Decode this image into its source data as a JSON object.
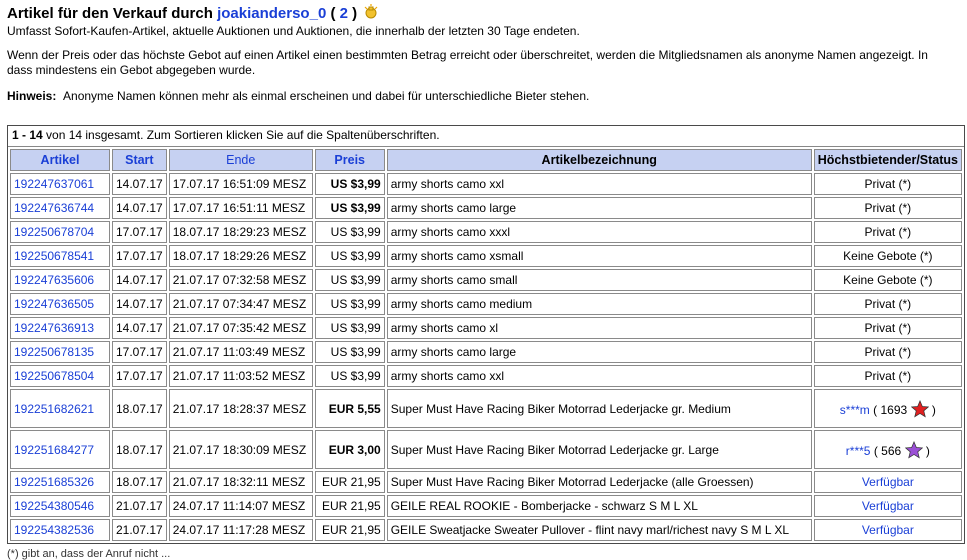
{
  "header": {
    "title_prefix": "Artikel für den Verkauf durch",
    "username": "joakianderso_0",
    "paren_open": "(",
    "feedback_count": "2",
    "paren_close": ")",
    "subtitle": "Umfasst Sofort-Kaufen-Artikel, aktuelle Auktionen und Auktionen, die innerhalb der letzten 30 Tage endeten."
  },
  "notice": {
    "line1": "Wenn der Preis oder das höchste Gebot auf einen Artikel einen bestimmten Betrag erreicht oder überschreitet, werden die Mitgliedsnamen als anonyme Namen angezeigt. In",
    "line2": "dass mindestens ein Gebot abgegeben wurde.",
    "hint_label": "Hinweis:",
    "hint_text": "Anonyme Namen können mehr als einmal erscheinen und dabei für unterschiedliche Bieter stehen."
  },
  "table": {
    "range": "1 - 14",
    "count_text": "von 14 insgesamt. Zum Sortieren klicken Sie auf die Spaltenüberschriften.",
    "columns": {
      "artikel": "Artikel",
      "start": "Start",
      "ende": "Ende",
      "preis": "Preis",
      "bezeichnung": "Artikelbezeichnung",
      "status": "Höchstbietender/Status"
    },
    "rows": [
      {
        "id": "192247637061",
        "start": "14.07.17",
        "end": "17.07.17 16:51:09 MESZ",
        "price": "US $3,99",
        "price_bold": true,
        "title": "army shorts camo xxl",
        "status": "Privat (*)",
        "status_link": false
      },
      {
        "id": "192247636744",
        "start": "14.07.17",
        "end": "17.07.17 16:51:11 MESZ",
        "price": "US $3,99",
        "price_bold": true,
        "title": "army shorts camo large",
        "status": "Privat (*)",
        "status_link": false
      },
      {
        "id": "192250678704",
        "start": "17.07.17",
        "end": "18.07.17 18:29:23 MESZ",
        "price": "US $3,99",
        "price_bold": false,
        "title": "army shorts camo xxxl",
        "status": "Privat (*)",
        "status_link": false
      },
      {
        "id": "192250678541",
        "start": "17.07.17",
        "end": "18.07.17 18:29:26 MESZ",
        "price": "US $3,99",
        "price_bold": false,
        "title": "army shorts camo xsmall",
        "status": "Keine Gebote (*)",
        "status_link": false
      },
      {
        "id": "192247635606",
        "start": "14.07.17",
        "end": "21.07.17 07:32:58 MESZ",
        "price": "US $3,99",
        "price_bold": false,
        "title": "army shorts camo small",
        "status": "Keine Gebote (*)",
        "status_link": false
      },
      {
        "id": "192247636505",
        "start": "14.07.17",
        "end": "21.07.17 07:34:47 MESZ",
        "price": "US $3,99",
        "price_bold": false,
        "title": "army shorts camo medium",
        "status": "Privat (*)",
        "status_link": false
      },
      {
        "id": "192247636913",
        "start": "14.07.17",
        "end": "21.07.17 07:35:42 MESZ",
        "price": "US $3,99",
        "price_bold": false,
        "title": "army shorts camo xl",
        "status": "Privat (*)",
        "status_link": false
      },
      {
        "id": "192250678135",
        "start": "17.07.17",
        "end": "21.07.17 11:03:49 MESZ",
        "price": "US $3,99",
        "price_bold": false,
        "title": "army shorts camo large",
        "status": "Privat (*)",
        "status_link": false
      },
      {
        "id": "192250678504",
        "start": "17.07.17",
        "end": "21.07.17 11:03:52 MESZ",
        "price": "US $3,99",
        "price_bold": false,
        "title": "army shorts camo xxl",
        "status": "Privat (*)",
        "status_link": false
      },
      {
        "id": "192251682621",
        "start": "18.07.17",
        "end": "21.07.17 18:28:37 MESZ",
        "price": "EUR 5,55",
        "price_bold": true,
        "title": "Super Must Have Racing Biker Motorrad Lederjacke gr. Medium",
        "bidder": "s***m",
        "feedback": "1693",
        "star": "red-star-icon",
        "star_color": "#e02020",
        "tall": true
      },
      {
        "id": "192251684277",
        "start": "18.07.17",
        "end": "21.07.17 18:30:09 MESZ",
        "price": "EUR 3,00",
        "price_bold": true,
        "title": "Super Must Have Racing Biker Motorrad Lederjacke gr. Large",
        "bidder": "r***5",
        "feedback": "566",
        "star": "purple-star-icon",
        "star_color": "#9b4fd6",
        "tall": true
      },
      {
        "id": "192251685326",
        "start": "18.07.17",
        "end": "21.07.17 18:32:11 MESZ",
        "price": "EUR 21,95",
        "price_bold": false,
        "title": "Super Must Have Racing Biker Motorrad Lederjacke (alle Groessen)",
        "status": "Verfügbar",
        "status_link": true
      },
      {
        "id": "192254380546",
        "start": "21.07.17",
        "end": "24.07.17 11:14:07 MESZ",
        "price": "EUR 21,95",
        "price_bold": false,
        "title": "GEILE REAL ROOKIE - Bomberjacke - schwarz S M L XL",
        "status": "Verfügbar",
        "status_link": true
      },
      {
        "id": "192254382536",
        "start": "21.07.17",
        "end": "24.07.17 11:17:28 MESZ",
        "price": "EUR 21,95",
        "price_bold": false,
        "title": "GEILE Sweatjacke Sweater Pullover - flint navy marl/richest navy S M L XL",
        "status": "Verfügbar",
        "status_link": true
      }
    ]
  },
  "footer": {
    "text": "(*) gibt an, dass der Anruf nicht ..."
  }
}
